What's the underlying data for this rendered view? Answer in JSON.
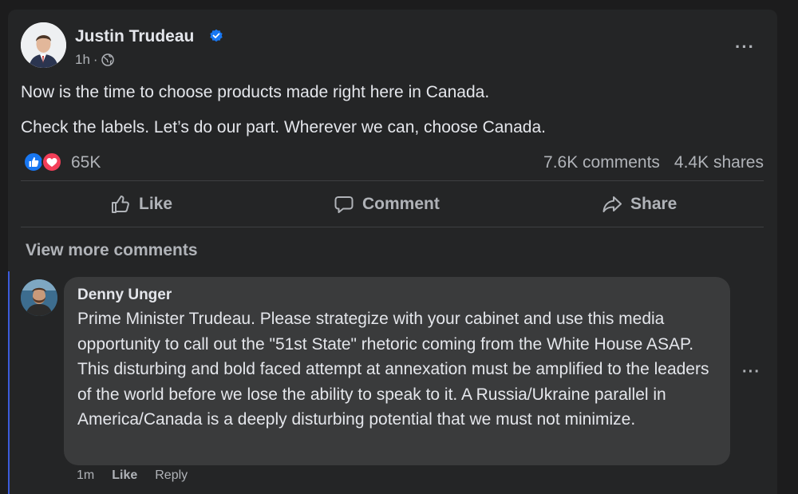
{
  "post": {
    "author": "Justin Trudeau",
    "time": "1h",
    "separator": "·",
    "text_line1": "Now is the time to choose products made right here in Canada.",
    "text_line2": "Check the labels. Let’s do our part. Wherever we can, choose Canada.",
    "reactions_count": "65K",
    "comments_count": "7.6K comments",
    "shares_count": "4.4K shares",
    "more_icon": "···"
  },
  "actions": {
    "like": "Like",
    "comment": "Comment",
    "share": "Share"
  },
  "view_more_comments": "View more comments",
  "comment": {
    "author": "Denny Unger",
    "text": "Prime Minister Trudeau. Please strategize with your cabinet and use this media opportunity to call out the \"51st State\" rhetoric coming from the White House ASAP. This disturbing and bold faced attempt at annexation must be amplified to the leaders of the world before we lose the ability to speak to it. A Russia/Ukraine parallel in America/Canada is a deeply disturbing potential that we must not minimize.",
    "time": "1m",
    "like": "Like",
    "reply": "Reply",
    "more_icon": "···"
  },
  "colors": {
    "background": "#242526",
    "bubble": "#3a3b3c",
    "like_blue": "#1877f2",
    "love_red": "#f33e58"
  }
}
